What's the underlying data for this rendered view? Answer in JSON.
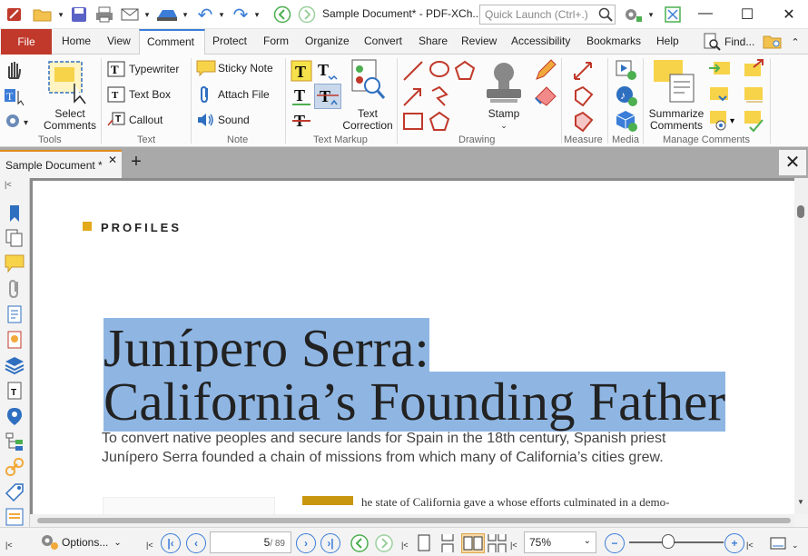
{
  "window": {
    "title": "Sample Document* - PDF-XCh..",
    "search_placeholder": "Quick Launch (Ctrl+.)",
    "minimize": "—",
    "maximize": "☐",
    "close": "✕"
  },
  "ribbon_tabs": [
    "File",
    "Home",
    "View",
    "Comment",
    "Protect",
    "Form",
    "Organize",
    "Convert",
    "Share",
    "Review",
    "Accessibility",
    "Bookmarks",
    "Help"
  ],
  "find_label": "Find...",
  "ribbon": {
    "tools": {
      "select_comments_line1": "Select",
      "select_comments_line2": "Comments",
      "label": "Tools"
    },
    "text": {
      "typewriter": "Typewriter",
      "text_box": "Text Box",
      "callout": "Callout",
      "label": "Text"
    },
    "note": {
      "sticky_note": "Sticky Note",
      "attach_file": "Attach File",
      "sound": "Sound",
      "label": "Note"
    },
    "text_markup": {
      "text_correction_line1": "Text",
      "text_correction_line2": "Correction",
      "label": "Text Markup"
    },
    "drawing": {
      "stamp": "Stamp",
      "label": "Drawing"
    },
    "measure": {
      "label": "Measure"
    },
    "media": {
      "label": "Media"
    },
    "manage": {
      "summarize_line1": "Summarize",
      "summarize_line2": "Comments",
      "label": "Manage Comments"
    }
  },
  "document_tab": {
    "label": "Sample Document *",
    "close": "✕",
    "new_tab": "+",
    "close_all": "✕"
  },
  "page": {
    "section_label": "PROFILES",
    "heading_line1": "Junípero Serra:",
    "heading_line2": "California’s Founding Father",
    "subtitle": "To convert native peoples and secure lands for Spain in the 18th century, Spanish priest Junípero Serra founded a chain of missions from which many of California’s cities grew.",
    "body_start": "he state of California gave a     whose efforts culminated in a demo-"
  },
  "status": {
    "options": "Options...",
    "page_current": "5",
    "page_total": "/ 89",
    "zoom": "75%"
  },
  "colors": {
    "file_tab": "#c0392b",
    "accent_blue": "#3b7dd8",
    "highlight": "#8fb6e3",
    "profiles_square": "#e3a91a",
    "doc_tab_accent": "#e08a1e"
  }
}
